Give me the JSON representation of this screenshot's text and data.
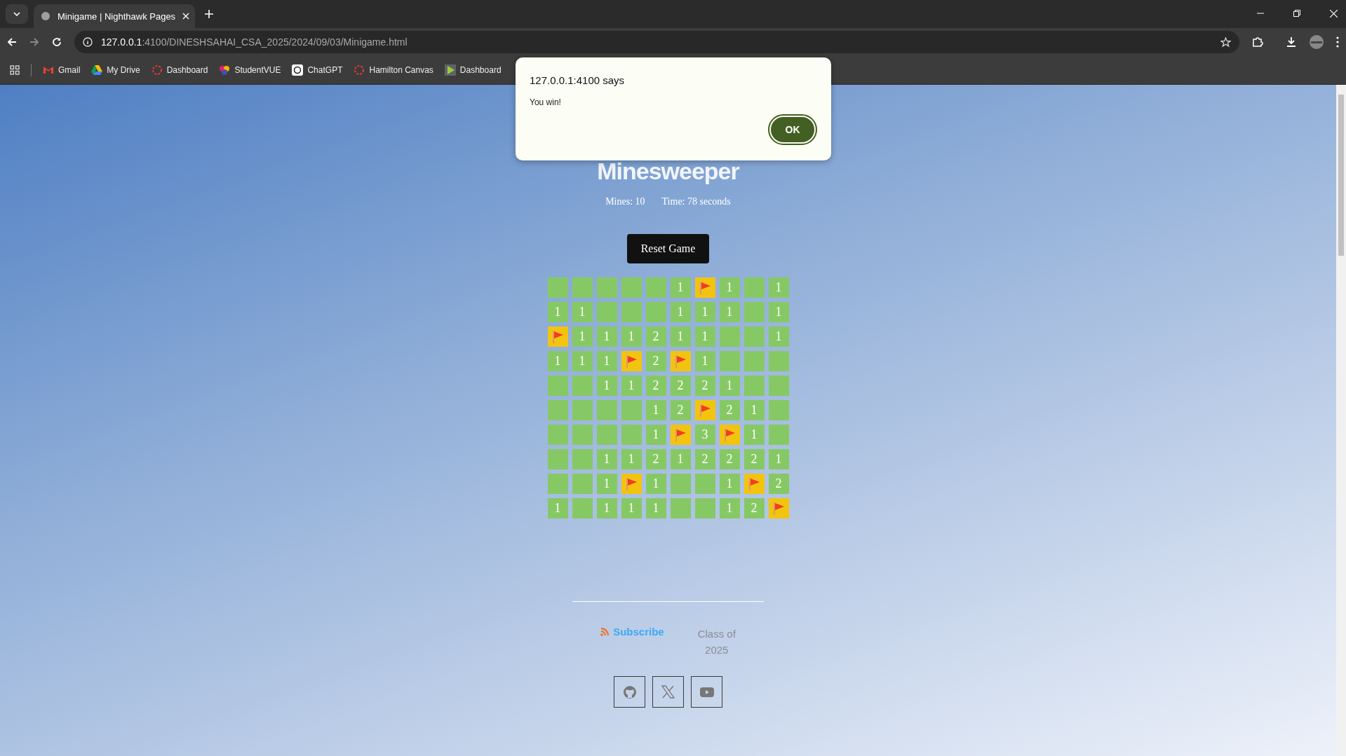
{
  "browser": {
    "tab": {
      "title": "Minigame | Nighthawk Pages",
      "selected": true
    },
    "address": {
      "host": "127.0.0.1",
      "path": ":4100/DINESHSAHAI_CSA_2025/2024/09/03/Minigame.html"
    },
    "bookmarks": [
      {
        "label": "Gmail",
        "kind": "gmail"
      },
      {
        "label": "My Drive",
        "kind": "drive"
      },
      {
        "label": "Dashboard",
        "kind": "ring"
      },
      {
        "label": "StudentVUE",
        "kind": "vue"
      },
      {
        "label": "ChatGPT",
        "kind": "gpt"
      },
      {
        "label": "Hamilton Canvas",
        "kind": "ring"
      },
      {
        "label": "Dashboard",
        "kind": "play"
      }
    ]
  },
  "dialog": {
    "title": "127.0.0.1:4100 says",
    "message": "You win!",
    "button": "OK"
  },
  "game": {
    "title": "Minesweeper",
    "mines": "Mines: 10",
    "time": "Time: 78 seconds",
    "reset": "Reset Game",
    "rows": [
      [
        {
          "kind": "empty"
        },
        {
          "kind": "empty"
        },
        {
          "kind": "empty"
        },
        {
          "kind": "empty"
        },
        {
          "kind": "empty"
        },
        {
          "kind": "number",
          "text": "1"
        },
        {
          "kind": "flag"
        },
        {
          "kind": "number",
          "text": "1"
        },
        {
          "kind": "empty"
        },
        {
          "kind": "number",
          "text": "1"
        }
      ],
      [
        {
          "kind": "number",
          "text": "1"
        },
        {
          "kind": "number",
          "text": "1"
        },
        {
          "kind": "empty"
        },
        {
          "kind": "empty"
        },
        {
          "kind": "empty"
        },
        {
          "kind": "number",
          "text": "1"
        },
        {
          "kind": "number",
          "text": "1"
        },
        {
          "kind": "number",
          "text": "1"
        },
        {
          "kind": "empty"
        },
        {
          "kind": "number",
          "text": "1"
        }
      ],
      [
        {
          "kind": "flag"
        },
        {
          "kind": "number",
          "text": "1"
        },
        {
          "kind": "number",
          "text": "1"
        },
        {
          "kind": "number",
          "text": "1"
        },
        {
          "kind": "number",
          "text": "2"
        },
        {
          "kind": "number",
          "text": "1"
        },
        {
          "kind": "number",
          "text": "1"
        },
        {
          "kind": "empty"
        },
        {
          "kind": "empty"
        },
        {
          "kind": "number",
          "text": "1"
        }
      ],
      [
        {
          "kind": "number",
          "text": "1"
        },
        {
          "kind": "number",
          "text": "1"
        },
        {
          "kind": "number",
          "text": "1"
        },
        {
          "kind": "flag"
        },
        {
          "kind": "number",
          "text": "2"
        },
        {
          "kind": "flag"
        },
        {
          "kind": "number",
          "text": "1"
        },
        {
          "kind": "empty"
        },
        {
          "kind": "empty"
        },
        {
          "kind": "empty"
        }
      ],
      [
        {
          "kind": "empty"
        },
        {
          "kind": "empty"
        },
        {
          "kind": "number",
          "text": "1"
        },
        {
          "kind": "number",
          "text": "1"
        },
        {
          "kind": "number",
          "text": "2"
        },
        {
          "kind": "number",
          "text": "2"
        },
        {
          "kind": "number",
          "text": "2"
        },
        {
          "kind": "number",
          "text": "1"
        },
        {
          "kind": "empty"
        },
        {
          "kind": "empty"
        }
      ],
      [
        {
          "kind": "empty"
        },
        {
          "kind": "empty"
        },
        {
          "kind": "empty"
        },
        {
          "kind": "empty"
        },
        {
          "kind": "number",
          "text": "1"
        },
        {
          "kind": "number",
          "text": "2"
        },
        {
          "kind": "flag"
        },
        {
          "kind": "number",
          "text": "2"
        },
        {
          "kind": "number",
          "text": "1"
        },
        {
          "kind": "empty"
        }
      ],
      [
        {
          "kind": "empty"
        },
        {
          "kind": "empty"
        },
        {
          "kind": "empty"
        },
        {
          "kind": "empty"
        },
        {
          "kind": "number",
          "text": "1"
        },
        {
          "kind": "flag"
        },
        {
          "kind": "number",
          "text": "3"
        },
        {
          "kind": "flag"
        },
        {
          "kind": "number",
          "text": "1"
        },
        {
          "kind": "empty"
        }
      ],
      [
        {
          "kind": "empty"
        },
        {
          "kind": "empty"
        },
        {
          "kind": "number",
          "text": "1"
        },
        {
          "kind": "number",
          "text": "1"
        },
        {
          "kind": "number",
          "text": "2"
        },
        {
          "kind": "number",
          "text": "1"
        },
        {
          "kind": "number",
          "text": "2"
        },
        {
          "kind": "number",
          "text": "2"
        },
        {
          "kind": "number",
          "text": "2"
        },
        {
          "kind": "number",
          "text": "1"
        }
      ],
      [
        {
          "kind": "empty"
        },
        {
          "kind": "empty"
        },
        {
          "kind": "number",
          "text": "1"
        },
        {
          "kind": "flag"
        },
        {
          "kind": "number",
          "text": "1"
        },
        {
          "kind": "empty"
        },
        {
          "kind": "empty"
        },
        {
          "kind": "number",
          "text": "1"
        },
        {
          "kind": "flag"
        },
        {
          "kind": "number",
          "text": "2"
        }
      ],
      [
        {
          "kind": "number",
          "text": "1"
        },
        {
          "kind": "empty"
        },
        {
          "kind": "number",
          "text": "1"
        },
        {
          "kind": "number",
          "text": "1"
        },
        {
          "kind": "number",
          "text": "1"
        },
        {
          "kind": "empty"
        },
        {
          "kind": "empty"
        },
        {
          "kind": "number",
          "text": "1"
        },
        {
          "kind": "number",
          "text": "2"
        },
        {
          "kind": "flag"
        }
      ]
    ]
  },
  "footer": {
    "subscribe": "Subscribe",
    "class_line1": "Class of",
    "class_line2": "2025",
    "socials": [
      {
        "kind": "github"
      },
      {
        "kind": "x"
      },
      {
        "kind": "youtube"
      }
    ]
  }
}
